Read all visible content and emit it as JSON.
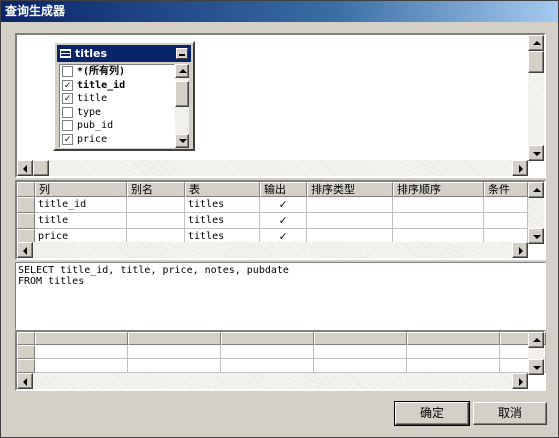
{
  "window": {
    "title": "查询生成器"
  },
  "table_window": {
    "title": "titles",
    "fields": [
      {
        "name": "*(所有列)",
        "checked": false,
        "bold": true
      },
      {
        "name": "title_id",
        "checked": true,
        "bold": true
      },
      {
        "name": "title",
        "checked": true,
        "bold": false
      },
      {
        "name": "type",
        "checked": false,
        "bold": false
      },
      {
        "name": "pub_id",
        "checked": false,
        "bold": false
      },
      {
        "name": "price",
        "checked": true,
        "bold": false
      }
    ]
  },
  "grid": {
    "headers": [
      "列",
      "别名",
      "表",
      "输出",
      "排序类型",
      "排序顺序",
      "条件"
    ],
    "rows": [
      {
        "column": "title_id",
        "alias": "",
        "table": "titles",
        "output": "✓"
      },
      {
        "column": "title",
        "alias": "",
        "table": "titles",
        "output": "✓"
      },
      {
        "column": "price",
        "alias": "",
        "table": "titles",
        "output": "✓"
      }
    ]
  },
  "sql": {
    "line1": "SELECT title_id, title, price, notes, pubdate",
    "line2": "FROM titles"
  },
  "buttons": {
    "ok": "确定",
    "cancel": "取消"
  },
  "icons": {
    "check": "✓"
  }
}
